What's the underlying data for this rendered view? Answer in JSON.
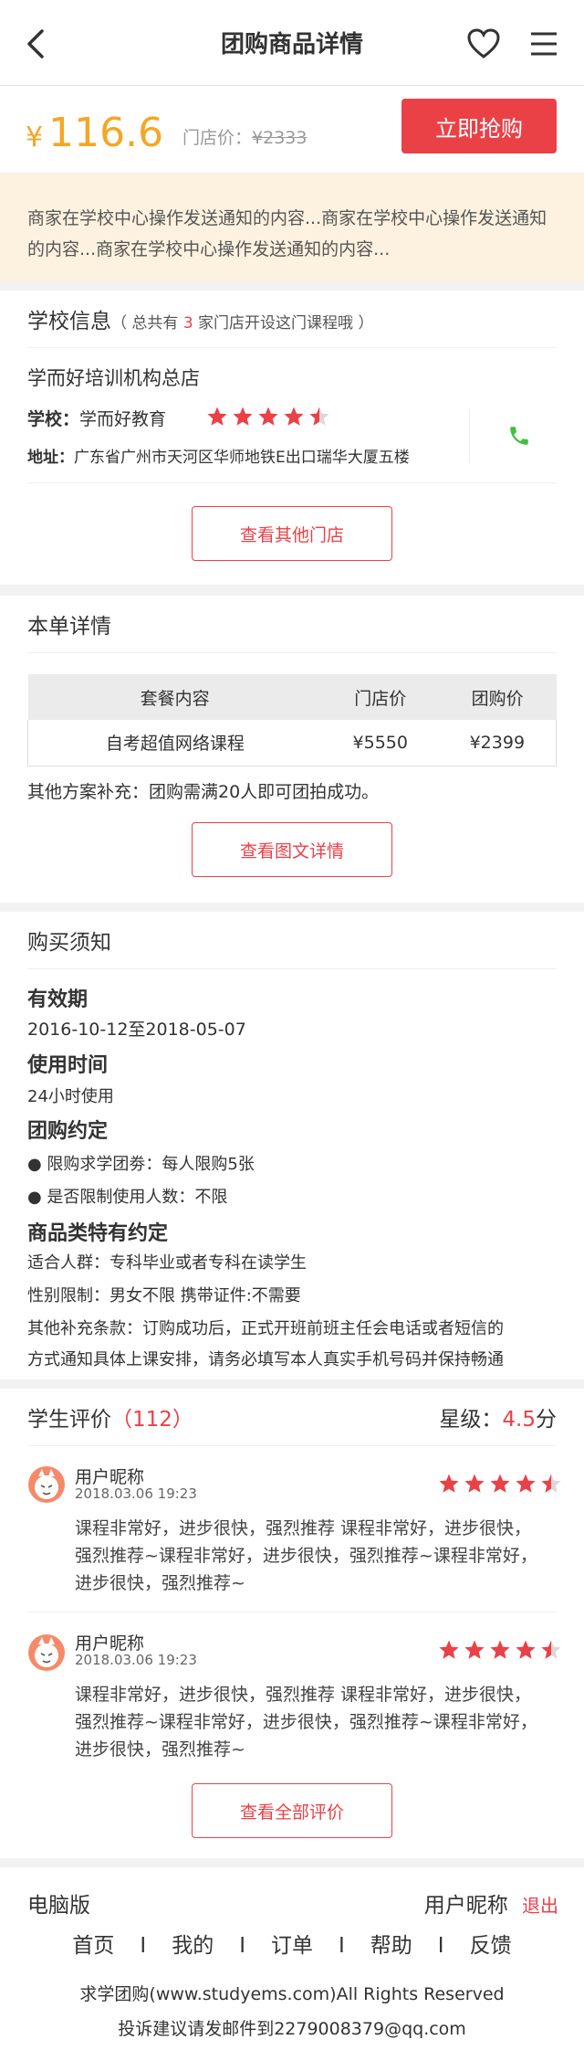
{
  "header": {
    "title": "团购商品详情"
  },
  "price": {
    "symbol": "¥",
    "current": "116.6",
    "original_label": "门店价：",
    "original_value": "¥2333",
    "buy_label": "立即抢购"
  },
  "notice": {
    "text": "商家在学校中心操作发送通知的内容...商家在学校中心操作发送通知的内容...商家在学校中心操作发送通知的内容..."
  },
  "school": {
    "heading": "学校信息",
    "sub_prefix": "（ 总共有 ",
    "store_count": "3",
    "sub_suffix": " 家门店开设这门课程哦 ）",
    "name": "学而好培训机构总店",
    "school_label": "学校：",
    "school_value": "学而好教育",
    "rating": 4.5,
    "address_label": "地址：",
    "address_value": "广东省广州市天河区华师地铁E出口瑞华大厦五楼",
    "more_stores_label": "查看其他门店"
  },
  "order": {
    "heading": "本单详情",
    "columns": [
      "套餐内容",
      "门店价",
      "团购价"
    ],
    "rows": [
      [
        "自考超值网络课程",
        "¥5550",
        "¥2399"
      ]
    ],
    "extra": "其他方案补充：团购需满20人即可团拍成功。",
    "detail_button": "查看图文详情"
  },
  "purchase_notes": {
    "heading": "购买须知",
    "validity_title": "有效期",
    "validity_value": "2016-10-12至2018-05-07",
    "usage_title": "使用时间",
    "usage_value": "24小时使用",
    "agreement_title": "团购约定",
    "agreement_items": [
      "● 限购求学团劵：每人限购5张",
      "● 是否限制使用人数：不限"
    ],
    "special_title": "商品类特有约定",
    "special_items": [
      "适合人群：专科毕业或者专科在读学生",
      "性别限制：男女不限  携带证件:不需要",
      "其他补充条款：订购成功后，正式开班前班主任会电话或者短信的",
      "方式通知具体上课安排，请务必填写本人真实手机号码并保持畅通"
    ]
  },
  "reviews": {
    "heading": "学生评价",
    "open_paren": "（",
    "count": "112",
    "close_paren": "）",
    "rating_label": "星级：",
    "rating_value": "4.5",
    "rating_unit": "分",
    "items": [
      {
        "user": "用户昵称",
        "time": "2018.03.06  19:23",
        "rating": 4.5,
        "lines": [
          "课程非常好，进步很快，强烈推荐  课程非常好，进步很快，",
          "强烈推荐~课程非常好，进步很快，强烈推荐~课程非常好，",
          "进步很快，强烈推荐~"
        ]
      },
      {
        "user": "用户昵称",
        "time": "2018.03.06  19:23",
        "rating": 4.5,
        "lines": [
          "课程非常好，进步很快，强烈推荐  课程非常好，进步很快，",
          "强烈推荐~课程非常好，进步很快，强烈推荐~课程非常好，",
          "进步很快，强烈推荐~"
        ]
      }
    ],
    "all_button": "查看全部评价"
  },
  "footer": {
    "pc_version": "电脑版",
    "user": "用户昵称",
    "logout": "退出",
    "nav": [
      "首页",
      "我的",
      "订单",
      "帮助",
      "反馈"
    ],
    "separator": "I",
    "copyright": "求学团购(www.studyems.com)All Rights Reserved",
    "feedback": "投诉建议请发邮件到2279008379@qq.com"
  },
  "colors": {
    "accent": "#ea4147",
    "price": "#f5a623",
    "notice_bg": "#fdf2df",
    "phone": "#3fbf3f"
  }
}
